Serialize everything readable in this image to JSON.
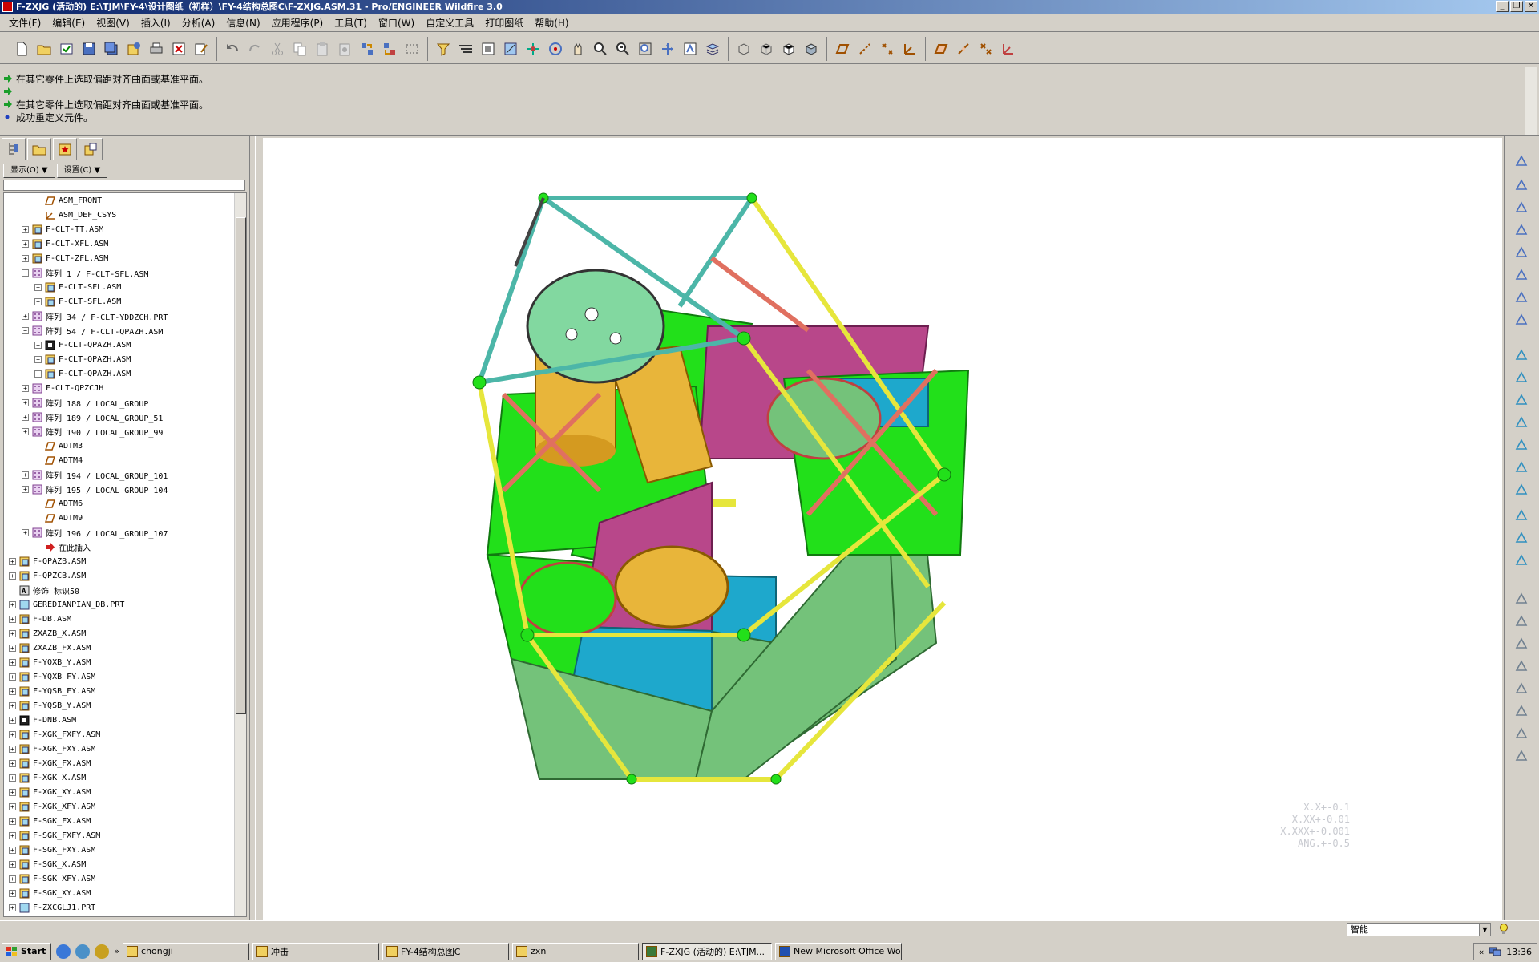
{
  "window": {
    "title": "F-ZXJG (活动的) E:\\TJM\\FY-4\\设计图纸（初样）\\FY-4结构总图C\\F-ZXJG.ASM.31 - Pro/ENGINEER Wildfire 3.0",
    "controls": [
      "_",
      "❐",
      "✕"
    ]
  },
  "menu": [
    "文件(F)",
    "编辑(E)",
    "视图(V)",
    "插入(I)",
    "分析(A)",
    "信息(N)",
    "应用程序(P)",
    "工具(T)",
    "窗口(W)",
    "自定义工具",
    "打印图纸",
    "帮助(H)"
  ],
  "messages": [
    {
      "icon": "arrow",
      "text": "在其它零件上选取偏距对齐曲面或基准平面。"
    },
    {
      "icon": "arrow",
      "text": ""
    },
    {
      "icon": "arrow",
      "text": "在其它零件上选取偏距对齐曲面或基准平面。"
    },
    {
      "icon": "dot",
      "text": "成功重定义元件。"
    }
  ],
  "tree_buttons": {
    "show": "显示(O) ▼",
    "settings": "设置(C) ▼"
  },
  "tree": [
    {
      "level": 2,
      "exp": "",
      "icon": "datum-plane",
      "label": "ASM_FRONT"
    },
    {
      "level": 2,
      "exp": "",
      "icon": "csys",
      "label": "ASM_DEF_CSYS"
    },
    {
      "level": 1,
      "exp": "+",
      "icon": "asm",
      "label": "F-CLT-TT.ASM"
    },
    {
      "level": 1,
      "exp": "+",
      "icon": "asm",
      "label": "F-CLT-XFL.ASM"
    },
    {
      "level": 1,
      "exp": "+",
      "icon": "asm",
      "label": "F-CLT-ZFL.ASM"
    },
    {
      "level": 1,
      "exp": "−",
      "icon": "pattern",
      "label": "阵列 1 / F-CLT-SFL.ASM"
    },
    {
      "level": 2,
      "exp": "+",
      "icon": "asm",
      "label": "F-CLT-SFL.ASM"
    },
    {
      "level": 2,
      "exp": "+",
      "icon": "asm",
      "label": "F-CLT-SFL.ASM"
    },
    {
      "level": 1,
      "exp": "+",
      "icon": "pattern",
      "label": "阵列 34 / F-CLT-YDDZCH.PRT"
    },
    {
      "level": 1,
      "exp": "−",
      "icon": "pattern",
      "label": "阵列 54 / F-CLT-QPAZH.ASM"
    },
    {
      "level": 2,
      "exp": "+",
      "icon": "asm-dark",
      "label": "F-CLT-QPAZH.ASM"
    },
    {
      "level": 2,
      "exp": "+",
      "icon": "asm",
      "label": "F-CLT-QPAZH.ASM"
    },
    {
      "level": 2,
      "exp": "+",
      "icon": "asm",
      "label": "F-CLT-QPAZH.ASM"
    },
    {
      "level": 1,
      "exp": "+",
      "icon": "pattern",
      "label": "F-CLT-QPZCJH"
    },
    {
      "level": 1,
      "exp": "+",
      "icon": "pattern",
      "label": "阵列 188 / LOCAL_GROUP"
    },
    {
      "level": 1,
      "exp": "+",
      "icon": "pattern",
      "label": "阵列 189 / LOCAL_GROUP_51"
    },
    {
      "level": 1,
      "exp": "+",
      "icon": "pattern",
      "label": "阵列 190 / LOCAL_GROUP_99"
    },
    {
      "level": 2,
      "exp": "",
      "icon": "datum-plane",
      "label": "ADTM3"
    },
    {
      "level": 2,
      "exp": "",
      "icon": "datum-plane",
      "label": "ADTM4"
    },
    {
      "level": 1,
      "exp": "+",
      "icon": "pattern",
      "label": "阵列 194 / LOCAL_GROUP_101"
    },
    {
      "level": 1,
      "exp": "+",
      "icon": "pattern",
      "label": "阵列 195 / LOCAL_GROUP_104"
    },
    {
      "level": 2,
      "exp": "",
      "icon": "datum-plane",
      "label": "ADTM6"
    },
    {
      "level": 2,
      "exp": "",
      "icon": "datum-plane",
      "label": "ADTM9"
    },
    {
      "level": 1,
      "exp": "+",
      "icon": "pattern",
      "label": "阵列 196 / LOCAL_GROUP_107"
    },
    {
      "level": 2,
      "exp": "",
      "icon": "insert-here",
      "label": "在此插入"
    },
    {
      "level": 0,
      "exp": "+",
      "icon": "asm",
      "label": "F-QPAZB.ASM"
    },
    {
      "level": 0,
      "exp": "+",
      "icon": "asm",
      "label": "F-QPZCB.ASM"
    },
    {
      "level": 0,
      "exp": "",
      "icon": "annotation",
      "label": "修饰 标识50"
    },
    {
      "level": 0,
      "exp": "+",
      "icon": "part",
      "label": "GEREDIANPIAN_DB.PRT"
    },
    {
      "level": 0,
      "exp": "+",
      "icon": "asm",
      "label": "F-DB.ASM"
    },
    {
      "level": 0,
      "exp": "+",
      "icon": "asm",
      "label": "ZXAZB_X.ASM"
    },
    {
      "level": 0,
      "exp": "+",
      "icon": "asm",
      "label": "ZXAZB_FX.ASM"
    },
    {
      "level": 0,
      "exp": "+",
      "icon": "asm",
      "label": "F-YQXB_Y.ASM"
    },
    {
      "level": 0,
      "exp": "+",
      "icon": "asm",
      "label": "F-YQXB_FY.ASM"
    },
    {
      "level": 0,
      "exp": "+",
      "icon": "asm",
      "label": "F-YQSB_FY.ASM"
    },
    {
      "level": 0,
      "exp": "+",
      "icon": "asm",
      "label": "F-YQSB_Y.ASM"
    },
    {
      "level": 0,
      "exp": "+",
      "icon": "asm-dark",
      "label": "F-DNB.ASM"
    },
    {
      "level": 0,
      "exp": "+",
      "icon": "asm",
      "label": "F-XGK_FXFY.ASM"
    },
    {
      "level": 0,
      "exp": "+",
      "icon": "asm",
      "label": "F-XGK_FXY.ASM"
    },
    {
      "level": 0,
      "exp": "+",
      "icon": "asm",
      "label": "F-XGK_FX.ASM"
    },
    {
      "level": 0,
      "exp": "+",
      "icon": "asm",
      "label": "F-XGK_X.ASM"
    },
    {
      "level": 0,
      "exp": "+",
      "icon": "asm",
      "label": "F-XGK_XY.ASM"
    },
    {
      "level": 0,
      "exp": "+",
      "icon": "asm",
      "label": "F-XGK_XFY.ASM"
    },
    {
      "level": 0,
      "exp": "+",
      "icon": "asm",
      "label": "F-SGK_FX.ASM"
    },
    {
      "level": 0,
      "exp": "+",
      "icon": "asm",
      "label": "F-SGK_FXFY.ASM"
    },
    {
      "level": 0,
      "exp": "+",
      "icon": "asm",
      "label": "F-SGK_FXY.ASM"
    },
    {
      "level": 0,
      "exp": "+",
      "icon": "asm",
      "label": "F-SGK_X.ASM"
    },
    {
      "level": 0,
      "exp": "+",
      "icon": "asm",
      "label": "F-SGK_XFY.ASM"
    },
    {
      "level": 0,
      "exp": "+",
      "icon": "asm",
      "label": "F-SGK_XY.ASM"
    },
    {
      "level": 0,
      "exp": "+",
      "icon": "part",
      "label": "F-ZXCGLJ1.PRT"
    }
  ],
  "tolerance": [
    "X.X+-0.1",
    "X.XX+-0.01",
    "X.XXX+-0.001",
    "ANG.+-0.5"
  ],
  "status": {
    "filter": "智能"
  },
  "taskbar": {
    "start": "Start",
    "tasks": [
      {
        "icon": "folder",
        "label": "chongji",
        "active": false
      },
      {
        "icon": "folder",
        "label": "冲击",
        "active": false
      },
      {
        "icon": "folder",
        "label": "FY-4结构总图C",
        "active": false
      },
      {
        "icon": "folder",
        "label": "zxn",
        "active": false
      },
      {
        "icon": "proe",
        "label": "F-ZXJG (活动的) E:\\TJM...",
        "active": true
      },
      {
        "icon": "word",
        "label": "New Microsoft Office Wo...",
        "active": false
      }
    ],
    "clock": "13:36",
    "tray_chevron": "«",
    "ql_chevron": "»"
  },
  "colors": {
    "green": "#22e01a",
    "blue": "#1ea8cc",
    "magenta": "#b8478a",
    "gold": "#e8b53a",
    "yellow": "#e6e63c",
    "salmon": "#e07060",
    "sage": "#74c27a",
    "teal": "#4cb6a8"
  }
}
